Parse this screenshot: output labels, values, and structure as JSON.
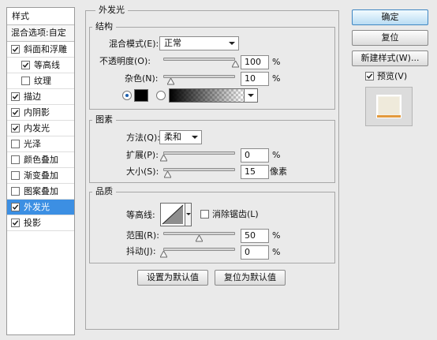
{
  "dialog": {
    "styles_header": "样式",
    "blending_options": "混合选项:自定",
    "styles": [
      {
        "label": "斜面和浮雕",
        "checked": true,
        "indent": false,
        "selected": false
      },
      {
        "label": "等高线",
        "checked": true,
        "indent": true,
        "selected": false
      },
      {
        "label": "纹理",
        "checked": false,
        "indent": true,
        "selected": false
      },
      {
        "label": "描边",
        "checked": true,
        "indent": false,
        "selected": false
      },
      {
        "label": "内阴影",
        "checked": true,
        "indent": false,
        "selected": false
      },
      {
        "label": "内发光",
        "checked": true,
        "indent": false,
        "selected": false
      },
      {
        "label": "光泽",
        "checked": false,
        "indent": false,
        "selected": false
      },
      {
        "label": "颜色叠加",
        "checked": false,
        "indent": false,
        "selected": false
      },
      {
        "label": "渐变叠加",
        "checked": false,
        "indent": false,
        "selected": false
      },
      {
        "label": "图案叠加",
        "checked": false,
        "indent": false,
        "selected": false
      },
      {
        "label": "外发光",
        "checked": true,
        "indent": false,
        "selected": true
      },
      {
        "label": "投影",
        "checked": true,
        "indent": false,
        "selected": false
      }
    ]
  },
  "outer_glow": {
    "section_title": "外发光",
    "structure": {
      "title": "结构",
      "blend_mode_label": "混合模式(E):",
      "blend_mode_value": "正常",
      "opacity_label": "不透明度(O):",
      "opacity_value": "100",
      "opacity_pct": 1.0,
      "noise_label": "杂色(N):",
      "noise_value": "10",
      "noise_pct": 0.1,
      "percent": "%"
    },
    "elements": {
      "title": "图素",
      "technique_label": "方法(Q):",
      "technique_value": "柔和",
      "spread_label": "扩展(P):",
      "spread_value": "0",
      "spread_pct": 0.0,
      "size_label": "大小(S):",
      "size_value": "15",
      "size_pct": 0.06,
      "size_unit": "像素",
      "percent": "%"
    },
    "quality": {
      "title": "品质",
      "contour_label": "等高线:",
      "anti_alias_label": "消除锯齿(L)",
      "anti_alias_checked": false,
      "range_label": "范围(R):",
      "range_value": "50",
      "range_pct": 0.5,
      "jitter_label": "抖动(J):",
      "jitter_value": "0",
      "jitter_pct": 0.0,
      "percent": "%"
    },
    "make_default_label": "设置为默认值",
    "reset_default_label": "复位为默认值"
  },
  "actions": {
    "ok_label": "确定",
    "reset_label": "复位",
    "new_style_label": "新建样式(W)...",
    "preview_label": "预览(V)",
    "preview_checked": true
  },
  "colors": {
    "selection": "#3c8fe3",
    "glow_color": "#000000",
    "preview_stroke": "#e39a3d"
  }
}
